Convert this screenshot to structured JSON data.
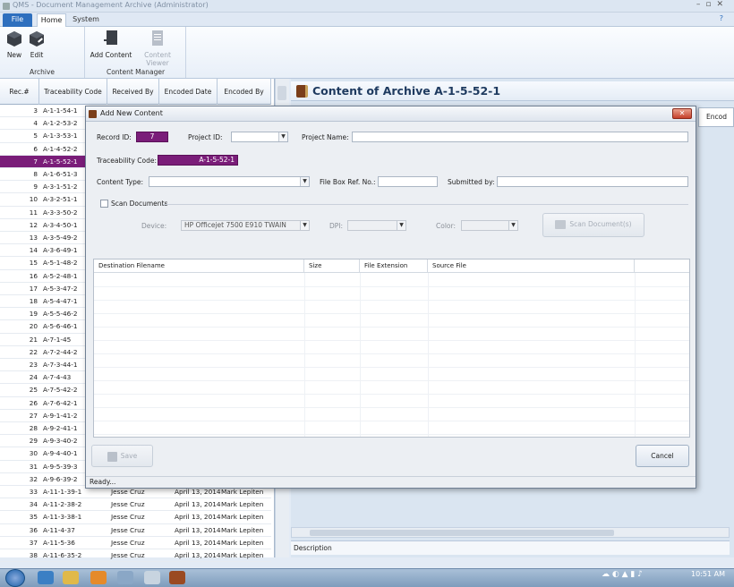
{
  "window": {
    "title": "QMS - Document Management Archive (Administrator)"
  },
  "ribbon": {
    "tabs": [
      "File",
      "Home",
      "System"
    ],
    "groups": [
      {
        "label": "Archive",
        "buttons": [
          "New",
          "Edit"
        ]
      },
      {
        "label": "Content Manager",
        "buttons": [
          "Add Content",
          "Content Viewer"
        ]
      }
    ]
  },
  "grid": {
    "headers": [
      "Rec.#",
      "Traceability Code",
      "Received By",
      "Encoded Date",
      "Encoded By"
    ],
    "selected_index": 4,
    "rows": [
      {
        "rec": "3",
        "code": "A-1-1-54-1",
        "received": "",
        "date": "",
        "by": ""
      },
      {
        "rec": "4",
        "code": "A-1-2-53-2",
        "received": "",
        "date": "",
        "by": ""
      },
      {
        "rec": "5",
        "code": "A-1-3-53-1",
        "received": "",
        "date": "",
        "by": ""
      },
      {
        "rec": "6",
        "code": "A-1-4-52-2",
        "received": "",
        "date": "",
        "by": ""
      },
      {
        "rec": "7",
        "code": "A-1-5-52-1",
        "received": "",
        "date": "",
        "by": ""
      },
      {
        "rec": "8",
        "code": "A-1-6-51-3",
        "received": "",
        "date": "",
        "by": ""
      },
      {
        "rec": "9",
        "code": "A-3-1-51-2",
        "received": "",
        "date": "",
        "by": ""
      },
      {
        "rec": "10",
        "code": "A-3-2-51-1",
        "received": "",
        "date": "",
        "by": ""
      },
      {
        "rec": "11",
        "code": "A-3-3-50-2",
        "received": "",
        "date": "",
        "by": ""
      },
      {
        "rec": "12",
        "code": "A-3-4-50-1",
        "received": "",
        "date": "",
        "by": ""
      },
      {
        "rec": "13",
        "code": "A-3-5-49-2",
        "received": "",
        "date": "",
        "by": ""
      },
      {
        "rec": "14",
        "code": "A-3-6-49-1",
        "received": "",
        "date": "",
        "by": ""
      },
      {
        "rec": "15",
        "code": "A-5-1-48-2",
        "received": "",
        "date": "",
        "by": ""
      },
      {
        "rec": "16",
        "code": "A-5-2-48-1",
        "received": "",
        "date": "",
        "by": ""
      },
      {
        "rec": "17",
        "code": "A-5-3-47-2",
        "received": "",
        "date": "",
        "by": ""
      },
      {
        "rec": "18",
        "code": "A-5-4-47-1",
        "received": "",
        "date": "",
        "by": ""
      },
      {
        "rec": "19",
        "code": "A-5-5-46-2",
        "received": "",
        "date": "",
        "by": ""
      },
      {
        "rec": "20",
        "code": "A-5-6-46-1",
        "received": "",
        "date": "",
        "by": ""
      },
      {
        "rec": "21",
        "code": "A-7-1-45",
        "received": "",
        "date": "",
        "by": ""
      },
      {
        "rec": "22",
        "code": "A-7-2-44-2",
        "received": "",
        "date": "",
        "by": ""
      },
      {
        "rec": "23",
        "code": "A-7-3-44-1",
        "received": "",
        "date": "",
        "by": ""
      },
      {
        "rec": "24",
        "code": "A-7-4-43",
        "received": "",
        "date": "",
        "by": ""
      },
      {
        "rec": "25",
        "code": "A-7-5-42-2",
        "received": "",
        "date": "",
        "by": ""
      },
      {
        "rec": "26",
        "code": "A-7-6-42-1",
        "received": "",
        "date": "",
        "by": ""
      },
      {
        "rec": "27",
        "code": "A-9-1-41-2",
        "received": "",
        "date": "",
        "by": ""
      },
      {
        "rec": "28",
        "code": "A-9-2-41-1",
        "received": "",
        "date": "",
        "by": ""
      },
      {
        "rec": "29",
        "code": "A-9-3-40-2",
        "received": "",
        "date": "",
        "by": ""
      },
      {
        "rec": "30",
        "code": "A-9-4-40-1",
        "received": "",
        "date": "",
        "by": ""
      },
      {
        "rec": "31",
        "code": "A-9-5-39-3",
        "received": "",
        "date": "",
        "by": ""
      },
      {
        "rec": "32",
        "code": "A-9-6-39-2",
        "received": "",
        "date": "",
        "by": ""
      },
      {
        "rec": "33",
        "code": "A-11-1-39-1",
        "received": "Jesse Cruz",
        "date": "April 13, 2014",
        "by": "Mark Lepiten"
      },
      {
        "rec": "34",
        "code": "A-11-2-38-2",
        "received": "Jesse Cruz",
        "date": "April 13, 2014",
        "by": "Mark Lepiten"
      },
      {
        "rec": "35",
        "code": "A-11-3-38-1",
        "received": "Jesse Cruz",
        "date": "April 13, 2014",
        "by": "Mark Lepiten"
      },
      {
        "rec": "36",
        "code": "A-11-4-37",
        "received": "Jesse Cruz",
        "date": "April 13, 2014",
        "by": "Mark Lepiten"
      },
      {
        "rec": "37",
        "code": "A-11-5-36",
        "received": "Jesse Cruz",
        "date": "April 13, 2014",
        "by": "Mark Lepiten"
      },
      {
        "rec": "38",
        "code": "A-11-6-35-2",
        "received": "Jesse Cruz",
        "date": "April 13, 2014",
        "by": "Mark Lepiten"
      }
    ]
  },
  "archive_panel": {
    "title": "Content of Archive A-1-5-52-1",
    "tab_label": "Encod",
    "description_label": "Description"
  },
  "dialog": {
    "title": "Add New Content",
    "record_id_label": "Record ID:",
    "record_id_value": "7",
    "project_id_label": "Project ID:",
    "project_id_value": "",
    "project_name_label": "Project Name:",
    "project_name_value": "",
    "traceability_label": "Traceability Code:",
    "traceability_value": "A-1-5-52-1",
    "content_type_label": "Content Type:",
    "content_type_value": "",
    "file_box_label": "File Box Ref. No.:",
    "file_box_value": "",
    "submitted_by_label": "Submitted by:",
    "submitted_by_value": "",
    "scan_documents_label": "Scan Documents",
    "device_label": "Device:",
    "device_value": "HP Officejet 7500 E910 TWAIN",
    "dpi_label": "DPI:",
    "color_label": "Color:",
    "scan_button": "Scan Document(s)",
    "table_headers": [
      "Destination Filename",
      "Size",
      "File Extension",
      "Source File"
    ],
    "save_button": "Save",
    "cancel_button": "Cancel",
    "status": "Ready..."
  },
  "taskbar": {
    "time": "10:51 AM"
  },
  "colors": {
    "accent": "#7a1d79",
    "file_tab": "#2e6fbe",
    "panel_title": "#1e3a5f"
  }
}
